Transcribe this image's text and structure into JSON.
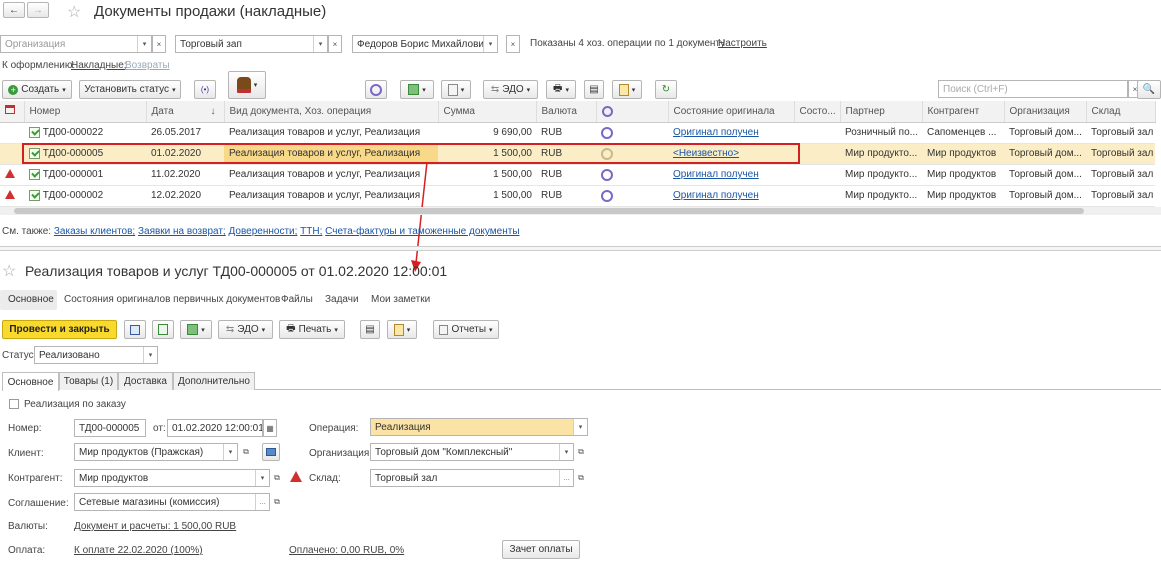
{
  "window": {
    "title": "Документы продажи (накладные)"
  },
  "filters": {
    "org_placeholder": "Организация",
    "warehouse": "Торговый зап",
    "manager": "Федоров Борис Михайлович",
    "shown_info": "Показаны 4 хоз. операции по 1 документу",
    "configure_link": "Настроить"
  },
  "to_process": {
    "label": "К оформлению:",
    "invoices": "Накладные;",
    "returns": "Возвраты"
  },
  "toolbar": {
    "create": "Создать",
    "set_status": "Установить статус",
    "edo": "ЭДО",
    "search_placeholder": "Поиск (Ctrl+F)"
  },
  "table": {
    "columns": [
      "Номер",
      "Дата",
      "Вид документа, Хоз. операция",
      "Сумма",
      "Валюта",
      "Состояние оригинала",
      "Состо...",
      "Партнер",
      "Контрагент",
      "Организация",
      "Склад"
    ],
    "rows": [
      {
        "number": "ТД00-000022",
        "date": "26.05.2017",
        "type": "Реализация товаров и услуг, Реализация",
        "sum": "9 690,00",
        "currency": "RUB",
        "original": "Оригинал получен",
        "partner": "Розничный по...",
        "counterparty": "Сапоменцев ...",
        "org": "Торговый дом...",
        "warehouse": "Торговый зал",
        "warn": false,
        "selected": false
      },
      {
        "number": "ТД00-000005",
        "date": "01.02.2020",
        "type": "Реализация товаров и услуг, Реализация",
        "sum": "1 500,00",
        "currency": "RUB",
        "original": "<Неизвестно>",
        "partner": "Мир продукто...",
        "counterparty": "Мир продуктов",
        "org": "Торговый дом...",
        "warehouse": "Торговый зал",
        "warn": false,
        "selected": true
      },
      {
        "number": "ТД00-000001",
        "date": "11.02.2020",
        "type": "Реализация товаров и услуг, Реализация",
        "sum": "1 500,00",
        "currency": "RUB",
        "original": "Оригинал получен",
        "partner": "Мир продукто...",
        "counterparty": "Мир продуктов",
        "org": "Торговый дом...",
        "warehouse": "Торговый зал",
        "warn": true,
        "selected": false
      },
      {
        "number": "ТД00-000002",
        "date": "12.02.2020",
        "type": "Реализация товаров и услуг, Реализация",
        "sum": "1 500,00",
        "currency": "RUB",
        "original": "Оригинал получен",
        "partner": "Мир продукто...",
        "counterparty": "Мир продуктов",
        "org": "Торговый дом...",
        "warehouse": "Торговый зал",
        "warn": true,
        "selected": false
      }
    ]
  },
  "see_also": {
    "label": "См. также:",
    "links": [
      "Заказы клиентов;",
      "Заявки на возврат;",
      "Доверенности;",
      "ТТН;",
      "Счета-фактуры и таможенные документы"
    ]
  },
  "doc": {
    "title": "Реализация товаров и услуг ТД00-000005 от 01.02.2020 12:00:01",
    "nav": [
      "Основное",
      "Состояния оригиналов первичных документов",
      "Файлы",
      "Задачи",
      "Мои заметки"
    ],
    "post_close": "Провести и закрыть",
    "edo": "ЭДО",
    "print": "Печать",
    "reports": "Отчеты",
    "status_label": "Статус:",
    "status_value": "Реализовано",
    "tabs": [
      "Основное",
      "Товары (1)",
      "Доставка",
      "Дополнительно"
    ],
    "by_order": "Реализация по заказу",
    "number_label": "Номер:",
    "number_value": "ТД00-000005",
    "from_label": "от:",
    "date_value": "01.02.2020 12:00:01",
    "operation_label": "Операция:",
    "operation_value": "Реализация",
    "client_label": "Клиент:",
    "client_value": "Мир продуктов (Пражская)",
    "org_label": "Организация:",
    "org_value": "Торговый дом \"Комплексный\"",
    "counterparty_label": "Контрагент:",
    "counterparty_value": "Мир продуктов",
    "warehouse_label": "Склад:",
    "warehouse_value": "Торговый зал",
    "agreement_label": "Соглашение:",
    "agreement_value": "Сетевые магазины (комиссия)",
    "currency_label": "Валюты:",
    "currency_link": "Документ и расчеты: 1 500,00 RUB",
    "payment_label": "Оплата:",
    "payment_link": "К оплате 22.02.2020 (100%)",
    "paid_link": "Оплачено: 0,00 RUB, 0%",
    "offset_button": "Зачет оплаты"
  }
}
